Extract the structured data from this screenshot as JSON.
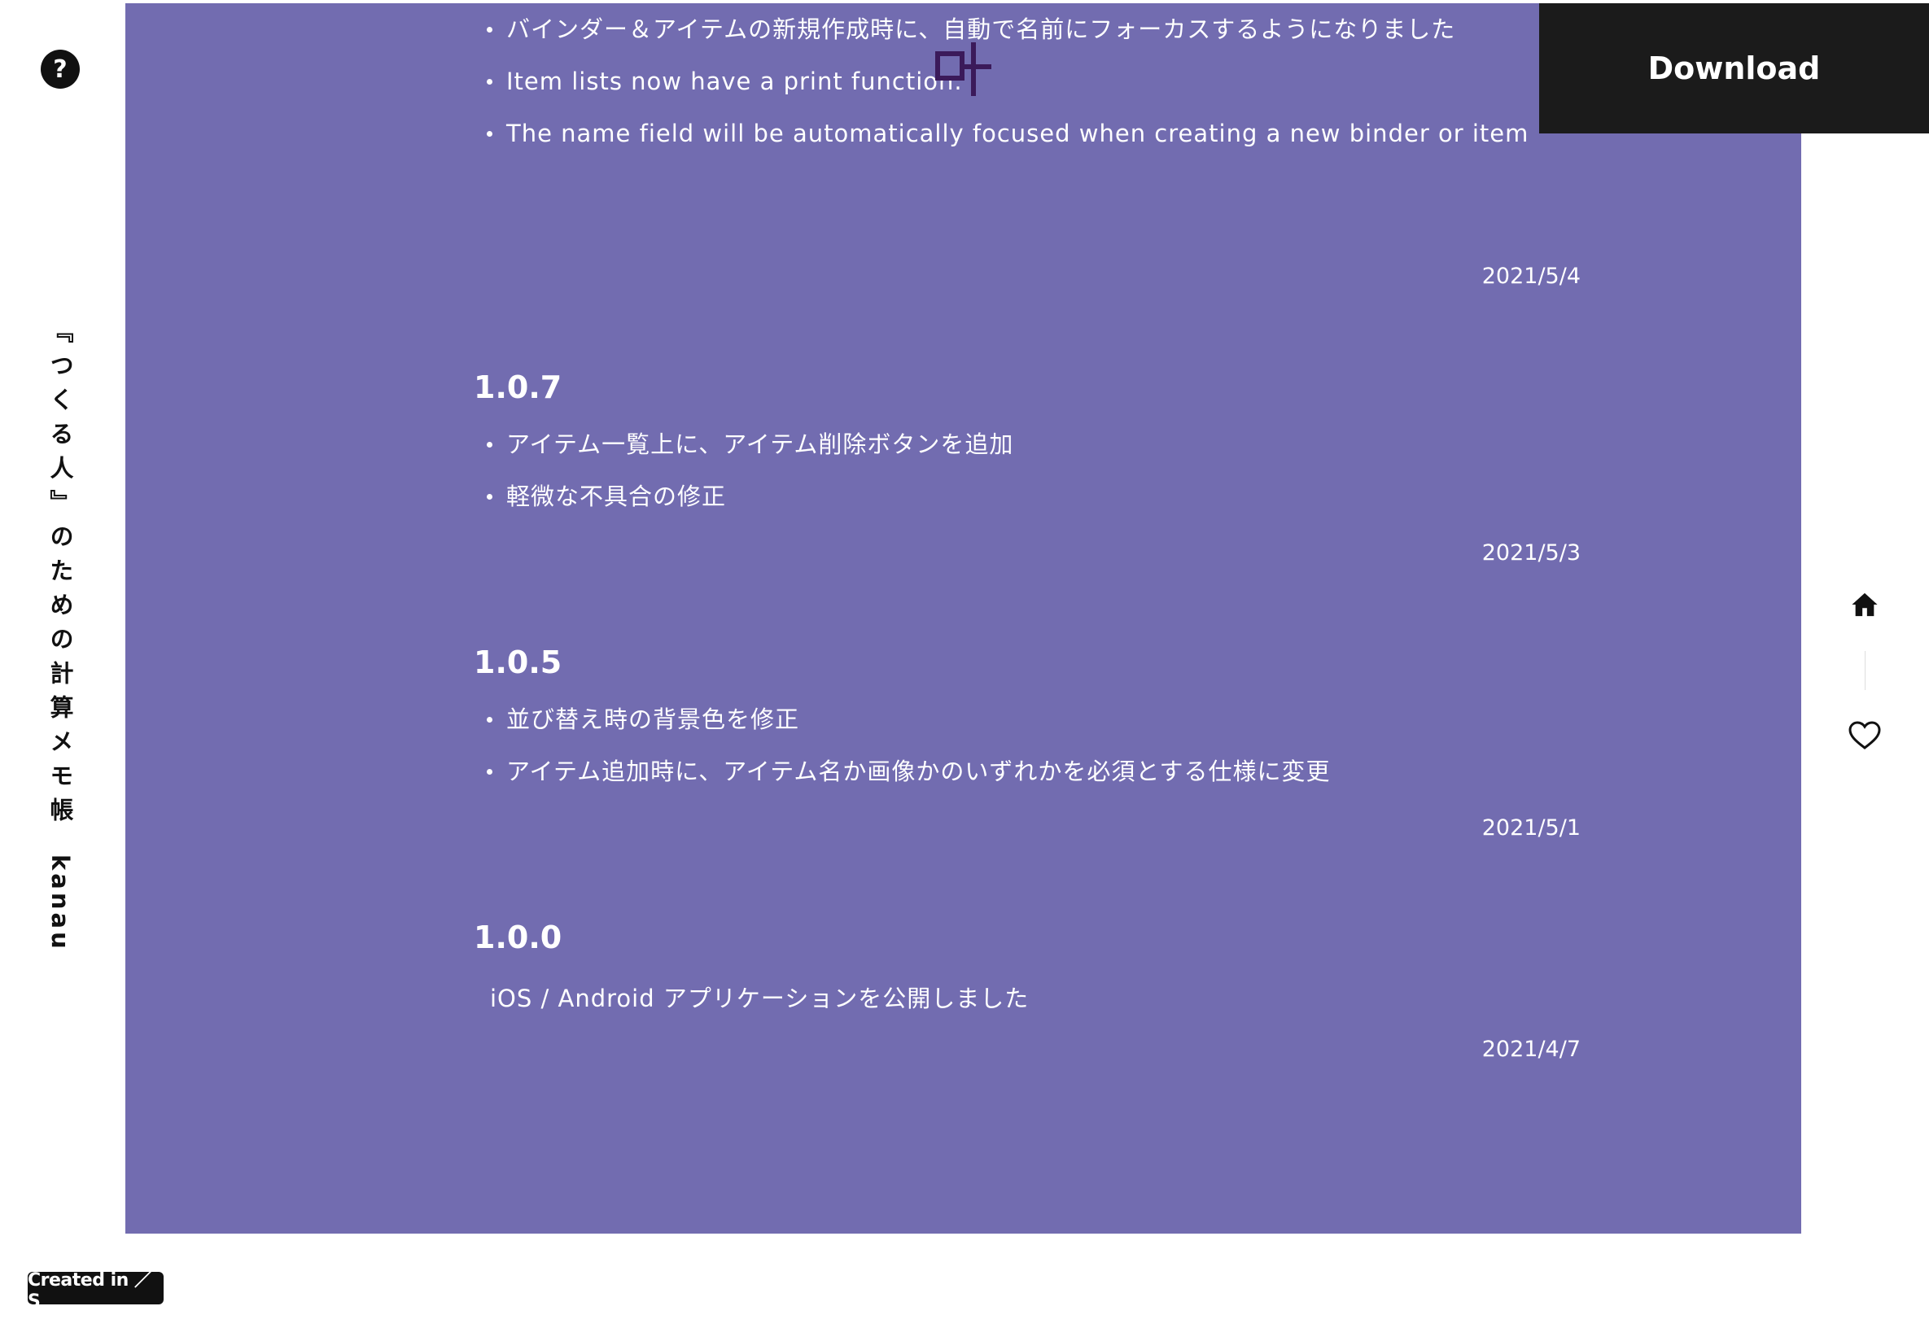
{
  "left_rail": {
    "help_label": "?",
    "title": "『つくる人』のための計算メモ帳",
    "brand": "kanau"
  },
  "download": {
    "label": "Download"
  },
  "changelog": {
    "top_items": [
      "バインダー＆アイテムの新規作成時に、自動で名前にフォーカスするようになりました",
      "Item lists now have a print function.",
      "The name field will be automatically focused when creating a new binder or item"
    ],
    "top_date": "2021/5/4",
    "v107": {
      "version": "1.0.7",
      "items": [
        "アイテム一覧上に、アイテム削除ボタンを追加",
        "軽微な不具合の修正"
      ],
      "date": "2021/5/3"
    },
    "v105": {
      "version": "1.0.5",
      "items": [
        "並び替え時の背景色を修正",
        "アイテム追加時に、アイテム名か画像かのいずれかを必須とする仕様に変更"
      ],
      "date": "2021/5/1"
    },
    "v100": {
      "version": "1.0.0",
      "text": "iOS / Android アプリケーションを公開しました",
      "date": "2021/4/7"
    }
  },
  "badge": {
    "label": "Created in ／S"
  },
  "colors": {
    "panel": "#726cb0",
    "download_bg": "#1b1b1b",
    "text_dark": "#111111"
  },
  "icons": [
    "help-icon",
    "home-icon",
    "heart-icon"
  ]
}
